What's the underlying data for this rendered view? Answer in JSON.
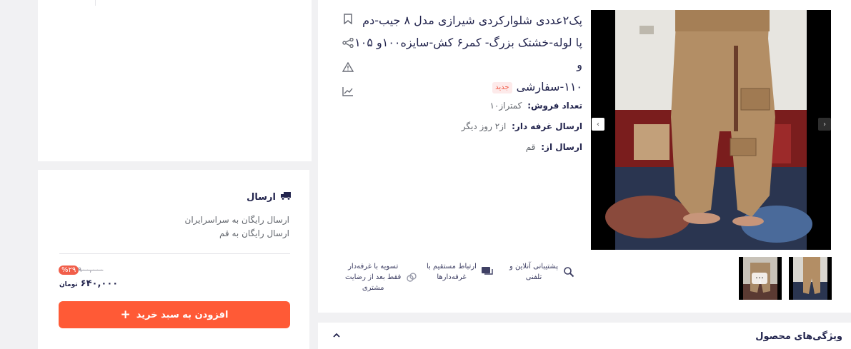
{
  "product": {
    "title_line1": "پک۲عددی شلوارکردی شیرازی مدل ۸ جیب-دم",
    "title_line2": "پا لوله-خشتک بزرگ- کمر۶ کش-سایزه۱۰۰و ۱۰۵ و",
    "title_line3": "۱۱۰-سفارشی",
    "new_badge": "جدید",
    "sales_label": "تعداد فروش:",
    "sales_value": "کمتراز۱۰",
    "ship_time_label": "ارسال غرفه دار:",
    "ship_time_value": "از۲ روز دیگر",
    "ship_from_label": "ارسال از:",
    "ship_from_value": "قم"
  },
  "side_icons": [
    "bookmark-icon",
    "share-icon",
    "report-icon",
    "chart-icon"
  ],
  "features": [
    {
      "line1": "پشتیبانی آنلاین و",
      "line2": "تلفنی",
      "line3": ""
    },
    {
      "line1": "ارتباط مستقیم با",
      "line2": "غرفه‌دارها",
      "line3": ""
    },
    {
      "line1": "تسویه با غرفه‌دار",
      "line2": "فقط بعد از رضایت",
      "line3": "مشتری"
    }
  ],
  "shipping": {
    "title": "ارسال",
    "line1": "ارسال رایگان به سراسرایران",
    "line2": "ارسال رایگان به قم"
  },
  "price": {
    "discount": "%۲۹",
    "old": "۹۰۰,۰۰۰",
    "new": "۶۴۰,۰۰۰",
    "currency": "تومان"
  },
  "add_to_cart": "افزودن به سبد خرید",
  "features_section_title": "ویژگی‌های محصول",
  "colors": {
    "accent": "#ff5a36",
    "discount": "#f15e4a",
    "text": "#23254e"
  }
}
